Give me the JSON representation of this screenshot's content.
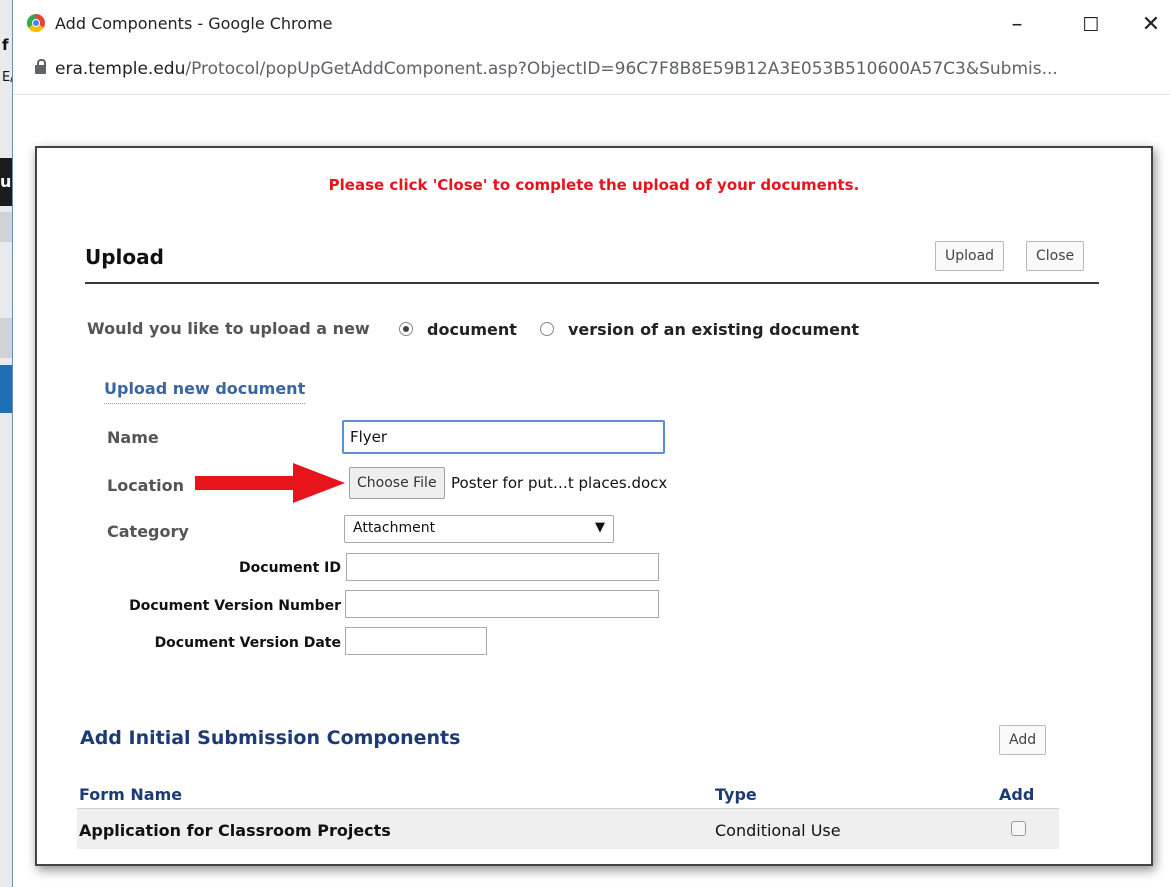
{
  "background": {
    "letter_top": "f",
    "letter_mid": "E/",
    "dark_tab_letter": "u"
  },
  "window": {
    "title": "Add Components - Google Chrome",
    "url_host": "era.temple.edu",
    "url_path": "/Protocol/popUpGetAddComponent.asp?ObjectID=96C7F8B8E59B12A3E053B510600A57C3&Submis..."
  },
  "notice": "Please click 'Close' to complete the upload of your documents.",
  "upload": {
    "title": "Upload",
    "upload_label": "Upload",
    "close_label": "Close",
    "question": "Would you like to upload a new",
    "option_document": "document",
    "option_version": "version of an existing document",
    "section_title": "Upload new document",
    "name_label": "Name",
    "name_value": "Flyer",
    "location_label": "Location",
    "choose_file_label": "Choose File",
    "file_name": "Poster for put…t places.docx",
    "category_label": "Category",
    "category_value": "Attachment",
    "doc_id_label": "Document ID",
    "doc_version_number_label": "Document Version Number",
    "doc_version_date_label": "Document Version Date",
    "doc_id_value": "",
    "doc_version_number_value": "",
    "doc_version_date_value": ""
  },
  "components": {
    "title": "Add Initial Submission  Components",
    "add_label": "Add",
    "columns": [
      "Form Name",
      "Type",
      "Add"
    ],
    "rows": [
      {
        "form_name": "Application for Classroom Projects",
        "type": "Conditional Use",
        "checked": false
      }
    ]
  },
  "colors": {
    "notice": "#e8141b",
    "heading_blue": "#1c3b73",
    "arrow": "#e8141b"
  }
}
